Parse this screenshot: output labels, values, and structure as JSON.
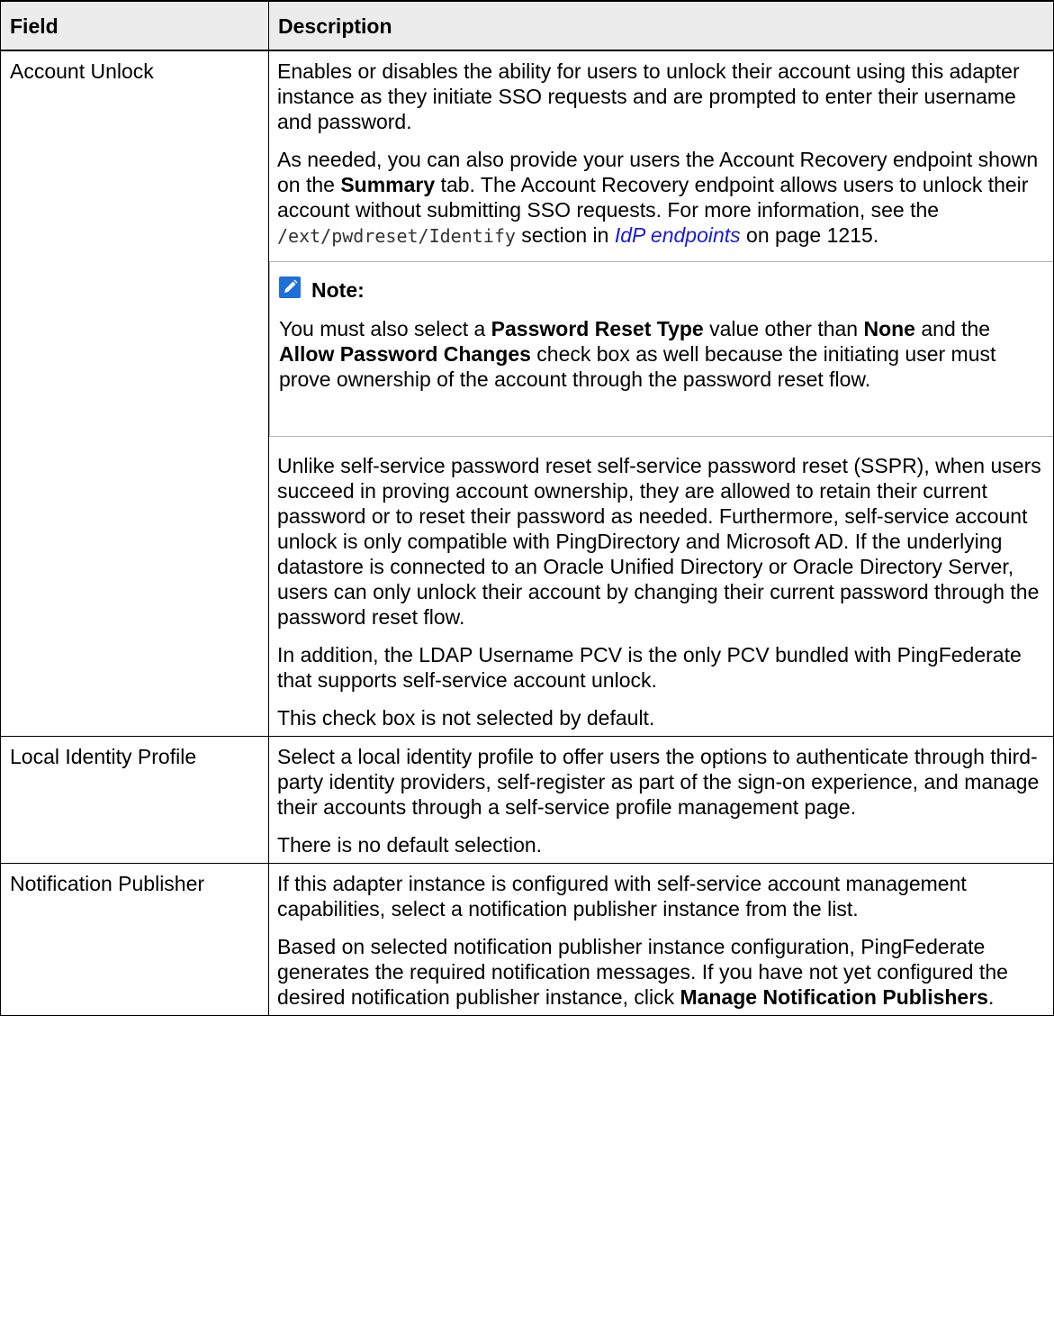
{
  "table": {
    "headers": [
      "Field",
      "Description"
    ],
    "rows": [
      {
        "field": "Account Unlock",
        "p1": "Enables or disables the ability for users to unlock their account using this adapter instance as they initiate SSO requests and are prompted to enter their username and password.",
        "p2": {
          "a": "As needed, you can also provide your users the Account Recovery endpoint shown on the ",
          "b": "Summary",
          "c": " tab. The Account Recovery endpoint allows users to unlock their account without submitting SSO requests. For more information, see the ",
          "code": "/ext/pwdreset/Identify",
          "d": " section in ",
          "link": "IdP endpoints",
          "e": " on page 1215."
        },
        "note": {
          "title": "Note:",
          "a": "You must also select a ",
          "b": "Password Reset Type",
          "c": " value other than ",
          "d": "None",
          "e": " and the ",
          "f": "Allow Password Changes",
          "g": " check box as well because the initiating user must prove ownership of the account through the password reset flow."
        },
        "p3": "Unlike self-service password reset self-service password reset (SSPR), when users succeed in proving account ownership, they are allowed to retain their current password or to reset their password as needed. Furthermore, self-service account unlock is only compatible with PingDirectory and Microsoft AD. If the underlying datastore is connected to an Oracle Unified Directory or Oracle Directory Server, users can only unlock their account by changing their current password through the password reset flow.",
        "p4": "In addition, the LDAP Username PCV is the only PCV bundled with PingFederate that supports self-service account unlock.",
        "p5": "This check box is not selected by default."
      },
      {
        "field": "Local Identity Profile",
        "p1": "Select a local identity profile to offer users the options to authenticate through third-party identity providers, self-register as part of the sign-on experience, and manage their accounts through a self-service profile management page.",
        "p2": "There is no default selection."
      },
      {
        "field": "Notification Publisher",
        "p1": "If this adapter instance is configured with self-service account management capabilities, select a notification publisher instance from the list.",
        "p2": {
          "a": "Based on selected notification publisher instance configuration, PingFederate generates the required notification messages. If you have not yet configured the desired notification publisher instance, click ",
          "b": "Manage Notification Publishers",
          "c": "."
        }
      }
    ]
  },
  "icons": {
    "note": "pencil-note-icon"
  },
  "colors": {
    "link": "#1a1ad6",
    "note_icon_bg": "#1f6fd8",
    "header_bg": "#ececec"
  }
}
